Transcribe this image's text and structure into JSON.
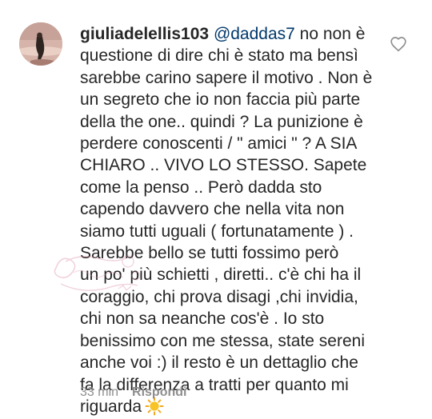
{
  "comment": {
    "username": "giuliadelellis103",
    "mention": "@daddas7",
    "lines": [
      " no non è",
      "questione di dire chi è stato ma bensì",
      "sarebbe carino sapere il motivo . Non è",
      "un segreto che io non faccia più parte",
      "della the one.. quindi ? La punizione è",
      "perdere conoscenti / \" amici \" ? A SIA",
      "CHIARO .. VIVO LO STESSO. Sapete",
      "come la penso .. Però  dadda sto",
      "capendo davvero che nella vita non",
      "siamo tutti uguali ( fortunatamente ) .",
      "Sarebbe bello se tutti fossimo però",
      "un po' più schietti , diretti.. c'è  chi ha il",
      "coraggio, chi prova disagi ,chi invidia,",
      "chi non sa neanche cos'è . Io sto",
      "benissimo con me stessa, state sereni",
      "anche voi :) il resto è un dettaglio che",
      "fa la differenza a tratti  per quanto mi",
      "riguarda"
    ],
    "emoji": "sun-emoji",
    "time": "33 min",
    "reply_label": "Rispondi",
    "like_icon": "heart-outline-icon"
  },
  "colors": {
    "text": "#262626",
    "mention": "#00376b",
    "secondary": "#8e8e8e",
    "sun": "#f7c325"
  }
}
